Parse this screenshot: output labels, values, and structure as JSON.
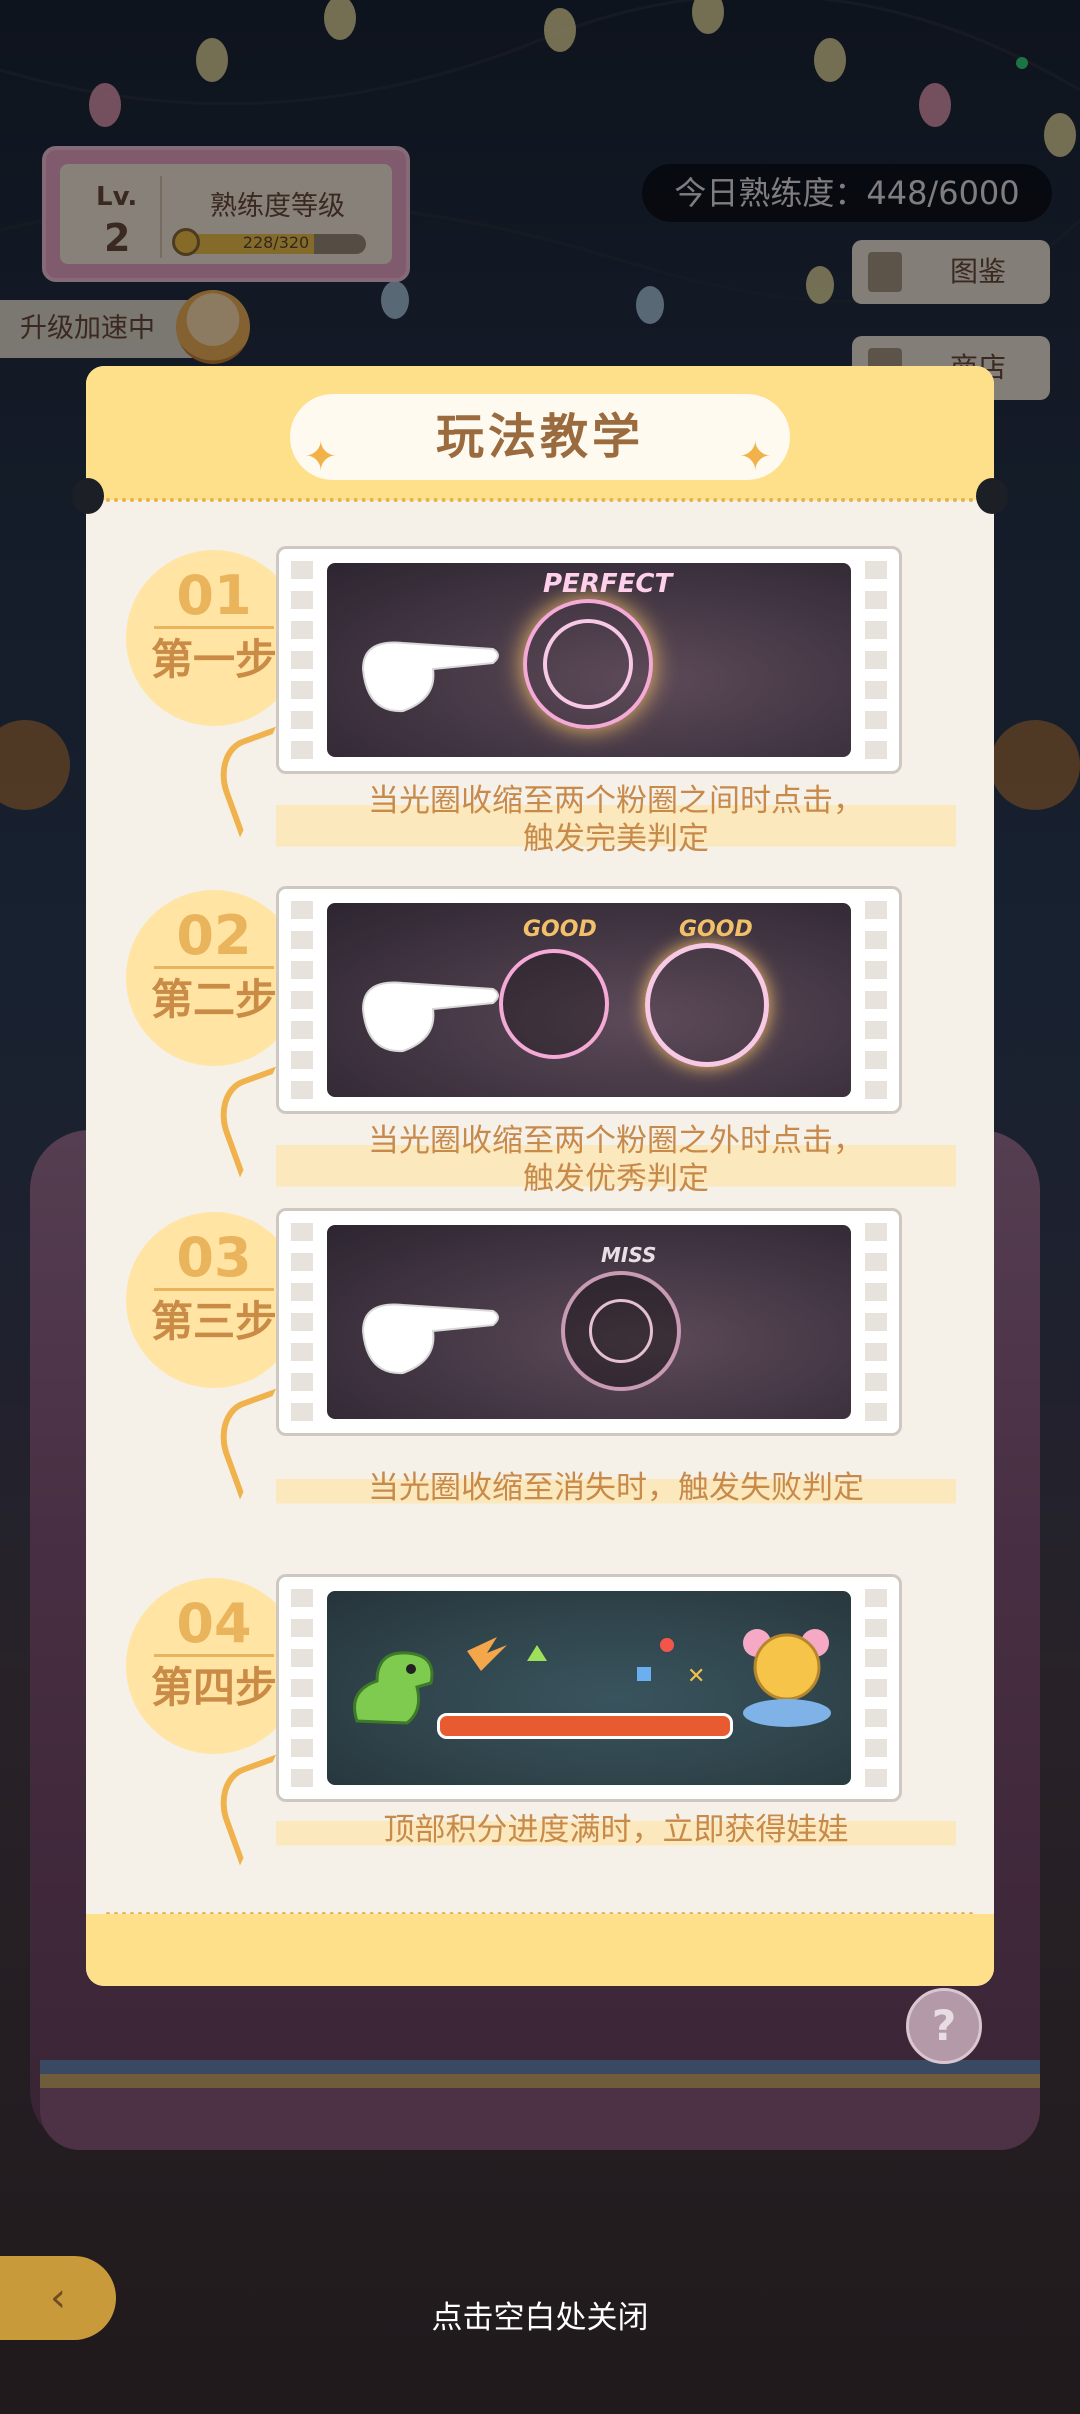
{
  "hud": {
    "level_label": "Lv.",
    "level_value": "2",
    "mastery_title": "熟练度等级",
    "mastery_progress_text": "228/320",
    "mastery_progress_fraction": 0.7125,
    "daily_mastery": "今日熟练度：448/6000",
    "boost_status": "升级加速中",
    "side_buttons": [
      "图鉴",
      "商店"
    ]
  },
  "modal": {
    "title": "玩法教学",
    "steps": [
      {
        "number": "01",
        "name": "第一步",
        "judge_labels": [
          "PERFECT"
        ],
        "description_line1": "当光圈收缩至两个粉圈之间时点击，",
        "description_line2": "触发完美判定"
      },
      {
        "number": "02",
        "name": "第二步",
        "judge_labels": [
          "GOOD",
          "GOOD"
        ],
        "description_line1": "当光圈收缩至两个粉圈之外时点击，",
        "description_line2": "触发优秀判定"
      },
      {
        "number": "03",
        "name": "第三步",
        "judge_labels": [
          "MISS"
        ],
        "description_line1": "当光圈收缩至消失时，触发失败判定",
        "description_line2": ""
      },
      {
        "number": "04",
        "name": "第四步",
        "judge_labels": [],
        "description_line1": "顶部积分进度满时，立即获得娃娃",
        "description_line2": ""
      }
    ]
  },
  "footer": {
    "close_hint": "点击空白处关闭",
    "help_label": "?"
  },
  "colors": {
    "modal_header": "#ffe08a",
    "modal_body": "#f6f1e8",
    "step_accent": "#eab45c",
    "description_text": "#c88a4a"
  }
}
